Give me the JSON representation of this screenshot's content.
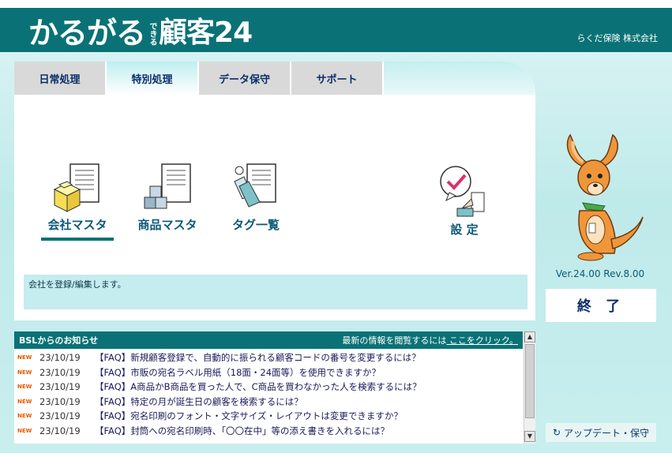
{
  "header": {
    "logo_main": "かるがる",
    "logo_small": "できる",
    "logo_brand": "顧客24",
    "company": "らくだ保険 株式会社"
  },
  "tabs": [
    {
      "label": "日常処理",
      "active": false
    },
    {
      "label": "特別処理",
      "active": true
    },
    {
      "label": "データ保守",
      "active": false
    },
    {
      "label": "サポート",
      "active": false
    }
  ],
  "functions": {
    "company_master": "会社マスタ",
    "product_master": "商品マスタ",
    "tag_list": "タグ一覧",
    "settings": "設 定"
  },
  "description": "会社を登録/編集します。",
  "news": {
    "title": "BSLからのお知らせ",
    "more_prefix": "最新の情報を閲覧するには",
    "more_link": " ここをクリック。",
    "new_badge": "NEW",
    "items": [
      {
        "date": "23/10/19",
        "text": "【FAQ】新規顧客登録で、自動的に振られる顧客コードの番号を変更するには？"
      },
      {
        "date": "23/10/19",
        "text": "【FAQ】市販の宛名ラベル用紙（18面・24面等）を使用できますか？"
      },
      {
        "date": "23/10/19",
        "text": "【FAQ】A商品かB商品を買った人で、C商品を買わなかった人を検索するには？"
      },
      {
        "date": "23/10/19",
        "text": "【FAQ】特定の月が誕生日の顧客を検索するには？"
      },
      {
        "date": "23/10/19",
        "text": "【FAQ】宛名印刷のフォント・文字サイズ・レイアウトは変更できますか？"
      },
      {
        "date": "23/10/19",
        "text": "【FAQ】封筒への宛名印刷時、「〇〇在中」等の添え書きを入れるには？"
      }
    ]
  },
  "version": "Ver.24.00 Rev.8.00",
  "exit_label": "終 了",
  "update_label": "アップデート・保守",
  "update_icon": "↻",
  "colors": {
    "brand": "#0a7276",
    "accent": "#c5ecef"
  }
}
